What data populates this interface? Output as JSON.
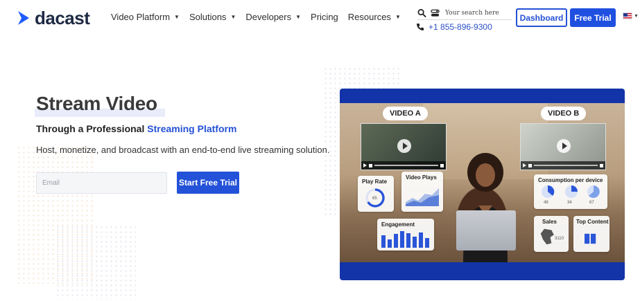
{
  "brand": {
    "name": "dacast",
    "accent": "#2451d6",
    "logo_mark_color": "#1f5bff"
  },
  "nav": {
    "items": [
      {
        "label": "Video Platform",
        "has_dropdown": true
      },
      {
        "label": "Solutions",
        "has_dropdown": true
      },
      {
        "label": "Developers",
        "has_dropdown": true
      },
      {
        "label": "Pricing",
        "has_dropdown": false
      },
      {
        "label": "Resources",
        "has_dropdown": true
      }
    ]
  },
  "header": {
    "search_placeholder": "Your search here",
    "phone": "+1 855-896-9300",
    "dashboard_label": "Dashboard",
    "free_trial_label": "Free Trial",
    "language_icon": "us-flag-icon"
  },
  "hero": {
    "title": "Stream Video",
    "subtitle_prefix": "Through a Professional ",
    "subtitle_accent": "Streaming Platform",
    "description": "Host, monetize, and broadcast with an end-to-end live streaming solution.",
    "email_placeholder": "Email",
    "cta_label": "Start Free Trial"
  },
  "mockup": {
    "video_a_label": "VIDEO A",
    "video_b_label": "VIDEO B",
    "cards": {
      "play_rate": {
        "title": "Play Rate",
        "value": "65"
      },
      "video_plays": {
        "title": "Video Plays"
      },
      "consumption": {
        "title": "Consumption per device",
        "values": [
          "48",
          "34",
          "67"
        ]
      },
      "engagement": {
        "title": "Engagement"
      },
      "sales": {
        "title": "Sales",
        "value": "3110"
      },
      "top_content": {
        "title": "Top Content"
      }
    }
  }
}
